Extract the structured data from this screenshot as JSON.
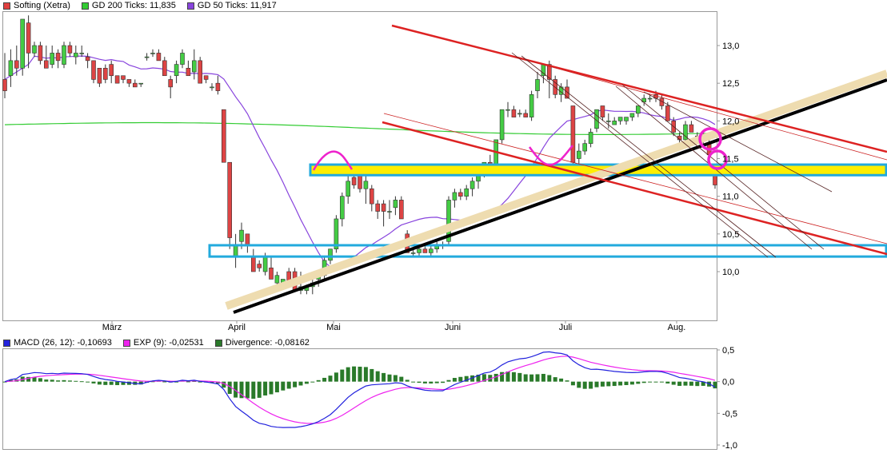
{
  "chart_data": [
    {
      "type": "candlestick",
      "title": "",
      "legend": [
        {
          "label": "Softing (Xetra)",
          "color": "#e04040"
        },
        {
          "label": "GD 200 Ticks: 11,835",
          "color": "#33cc33"
        },
        {
          "label": "GD 50 Ticks: 11,917",
          "color": "#8844dd"
        }
      ],
      "legend_placement": "top-left",
      "grid": false,
      "ylim": [
        9.3,
        13.3
      ],
      "yticks": [
        "10,0",
        "10,5",
        "11,0",
        "11,5",
        "12,0",
        "12,5",
        "13,0"
      ],
      "xticks": [
        "März",
        "April",
        "Mai",
        "Juni",
        "Juli",
        "Aug."
      ],
      "ohlc": [
        [
          12.55,
          12.9,
          12.3,
          12.4
        ],
        [
          12.6,
          12.95,
          12.45,
          12.8
        ],
        [
          12.8,
          13.0,
          12.6,
          12.7
        ],
        [
          12.7,
          13.35,
          12.6,
          13.35
        ],
        [
          13.3,
          13.4,
          12.7,
          12.9
        ],
        [
          12.9,
          13.05,
          12.85,
          13.0
        ],
        [
          13.0,
          13.05,
          12.75,
          12.8
        ],
        [
          12.8,
          13.0,
          12.7,
          12.7
        ],
        [
          12.75,
          13.0,
          12.7,
          12.9
        ],
        [
          12.9,
          12.95,
          12.7,
          12.8
        ],
        [
          12.75,
          13.05,
          12.7,
          13.0
        ],
        [
          13.0,
          13.05,
          12.85,
          12.9
        ],
        [
          12.85,
          13.0,
          12.75,
          12.9
        ],
        [
          12.9,
          13.0,
          12.85,
          12.9
        ],
        [
          12.85,
          12.9,
          12.7,
          12.8
        ],
        [
          12.8,
          12.8,
          12.5,
          12.55
        ],
        [
          12.7,
          12.7,
          12.45,
          12.5
        ],
        [
          12.7,
          12.75,
          12.5,
          12.55
        ],
        [
          12.75,
          12.8,
          12.5,
          12.6
        ],
        [
          12.6,
          12.6,
          12.5,
          12.5
        ],
        [
          12.6,
          12.6,
          12.5,
          12.55
        ],
        [
          12.55,
          12.55,
          12.45,
          12.5
        ],
        [
          12.5,
          12.55,
          12.45,
          12.45
        ],
        [
          12.5,
          12.5,
          12.45,
          12.5
        ],
        [
          12.85,
          12.9,
          12.8,
          12.85
        ],
        [
          12.9,
          12.95,
          12.85,
          12.9
        ],
        [
          12.9,
          12.95,
          12.8,
          12.8
        ],
        [
          12.8,
          12.85,
          12.6,
          12.6
        ],
        [
          12.55,
          12.6,
          12.3,
          12.45
        ],
        [
          12.6,
          12.8,
          12.5,
          12.75
        ],
        [
          12.75,
          12.95,
          12.7,
          12.9
        ],
        [
          12.7,
          12.8,
          12.6,
          12.6
        ],
        [
          12.65,
          12.95,
          12.55,
          12.8
        ],
        [
          12.8,
          12.85,
          12.5,
          12.5
        ],
        [
          12.6,
          12.6,
          12.5,
          12.55
        ],
        [
          12.45,
          12.5,
          12.4,
          12.45
        ],
        [
          12.5,
          12.6,
          12.35,
          12.4
        ],
        [
          12.15,
          12.15,
          11.45,
          11.45
        ],
        [
          11.45,
          11.45,
          10.3,
          10.45
        ],
        [
          10.2,
          10.5,
          10.05,
          10.35
        ],
        [
          10.4,
          10.65,
          10.3,
          10.55
        ],
        [
          10.5,
          10.5,
          10.25,
          10.35
        ],
        [
          10.2,
          10.3,
          10.0,
          10.0
        ],
        [
          10.1,
          10.15,
          10.0,
          10.05
        ],
        [
          10.0,
          10.25,
          9.95,
          10.2
        ],
        [
          10.05,
          10.2,
          9.9,
          9.9
        ],
        [
          9.85,
          10.0,
          9.8,
          9.95
        ],
        [
          9.85,
          9.9,
          9.8,
          9.9
        ],
        [
          10.0,
          10.05,
          9.8,
          9.85
        ],
        [
          10.0,
          10.05,
          9.75,
          9.75
        ],
        [
          9.75,
          10.0,
          9.7,
          9.8
        ],
        [
          9.75,
          9.8,
          9.7,
          9.8
        ],
        [
          9.8,
          9.9,
          9.7,
          9.85
        ],
        [
          9.9,
          10.0,
          9.8,
          9.95
        ],
        [
          9.95,
          10.2,
          9.9,
          10.15
        ],
        [
          10.15,
          10.3,
          10.1,
          10.3
        ],
        [
          10.3,
          10.75,
          10.25,
          10.7
        ],
        [
          10.7,
          11.05,
          10.6,
          11.0
        ],
        [
          11.0,
          11.3,
          10.9,
          11.2
        ],
        [
          11.25,
          11.35,
          11.1,
          11.15
        ],
        [
          11.3,
          11.35,
          11.05,
          11.1
        ],
        [
          11.1,
          11.3,
          10.9,
          11.2
        ],
        [
          11.1,
          11.15,
          10.8,
          10.9
        ],
        [
          10.9,
          10.95,
          10.7,
          10.8
        ],
        [
          10.9,
          10.95,
          10.6,
          10.8
        ],
        [
          10.8,
          10.95,
          10.7,
          10.8
        ],
        [
          10.85,
          11.0,
          10.75,
          10.95
        ],
        [
          10.95,
          11.0,
          10.7,
          10.7
        ],
        [
          10.5,
          10.55,
          10.25,
          10.25
        ],
        [
          10.25,
          10.3,
          10.2,
          10.25
        ],
        [
          10.25,
          10.35,
          10.2,
          10.3
        ],
        [
          10.3,
          10.35,
          10.25,
          10.25
        ],
        [
          10.25,
          10.35,
          10.2,
          10.3
        ],
        [
          10.3,
          10.4,
          10.25,
          10.35
        ],
        [
          10.35,
          10.4,
          10.3,
          10.35
        ],
        [
          10.4,
          11.0,
          10.35,
          10.95
        ],
        [
          10.95,
          11.1,
          10.85,
          11.05
        ],
        [
          11.05,
          11.1,
          10.95,
          11.0
        ],
        [
          11.0,
          11.15,
          10.95,
          11.1
        ],
        [
          11.1,
          11.25,
          11.0,
          11.2
        ],
        [
          11.2,
          11.4,
          11.1,
          11.35
        ],
        [
          11.35,
          11.45,
          11.25,
          11.45
        ],
        [
          11.45,
          11.55,
          11.3,
          11.3
        ],
        [
          11.4,
          11.75,
          11.35,
          11.75
        ],
        [
          11.75,
          12.15,
          11.7,
          12.15
        ],
        [
          12.15,
          12.25,
          12.05,
          12.15
        ],
        [
          12.15,
          12.2,
          12.05,
          12.05
        ],
        [
          12.1,
          12.15,
          12.05,
          12.1
        ],
        [
          12.1,
          12.15,
          12.05,
          12.05
        ],
        [
          12.05,
          12.4,
          12.0,
          12.35
        ],
        [
          12.4,
          12.65,
          12.3,
          12.55
        ],
        [
          12.6,
          12.75,
          12.5,
          12.75
        ],
        [
          12.75,
          12.8,
          12.3,
          12.55
        ],
        [
          12.55,
          12.6,
          12.3,
          12.35
        ],
        [
          12.35,
          12.5,
          12.25,
          12.45
        ],
        [
          12.45,
          12.55,
          12.3,
          12.3
        ],
        [
          12.2,
          12.2,
          11.4,
          11.45
        ],
        [
          11.5,
          11.7,
          11.4,
          11.6
        ],
        [
          11.6,
          11.75,
          11.55,
          11.7
        ],
        [
          11.7,
          11.9,
          11.65,
          11.85
        ],
        [
          11.9,
          12.15,
          11.85,
          12.15
        ],
        [
          12.2,
          12.2,
          12.0,
          12.05
        ],
        [
          12.0,
          12.1,
          11.9,
          12.0
        ],
        [
          11.95,
          12.05,
          11.95,
          12.0
        ],
        [
          12.0,
          12.05,
          11.95,
          12.05
        ],
        [
          12.0,
          12.05,
          11.95,
          12.05
        ],
        [
          12.05,
          12.1,
          12.0,
          12.1
        ],
        [
          12.1,
          12.2,
          12.05,
          12.2
        ],
        [
          12.25,
          12.35,
          12.2,
          12.3
        ],
        [
          12.3,
          12.35,
          12.25,
          12.3
        ],
        [
          12.35,
          12.4,
          12.25,
          12.3
        ],
        [
          12.3,
          12.35,
          12.15,
          12.2
        ],
        [
          12.2,
          12.25,
          12.0,
          12.0
        ],
        [
          12.0,
          12.05,
          11.8,
          11.85
        ],
        [
          11.8,
          11.85,
          11.7,
          11.75
        ],
        [
          11.75,
          12.0,
          11.7,
          11.95
        ],
        [
          11.95,
          12.0,
          11.85,
          11.85
        ],
        [
          11.8,
          11.85,
          11.7,
          11.75
        ],
        [
          11.75,
          11.85,
          11.7,
          11.8
        ],
        [
          11.7,
          11.75,
          11.55,
          11.55
        ],
        [
          11.35,
          11.35,
          11.1,
          11.15
        ]
      ],
      "yaxis_position": "right"
    },
    {
      "type": "line",
      "legend": [
        {
          "label": "MACD (26, 12): -0,10693",
          "color": "#2222dd"
        },
        {
          "label": "EXP (9): -0,02531",
          "color": "#ee22ee"
        },
        {
          "label": "Divergence: -0,08162",
          "color": "#2a7a2a"
        }
      ],
      "legend_placement": "top-left",
      "ylim": [
        -1.0,
        0.5
      ],
      "yticks": [
        "0,5",
        "0,0",
        "-0,5",
        "-1,0"
      ],
      "yaxis_position": "right"
    }
  ]
}
